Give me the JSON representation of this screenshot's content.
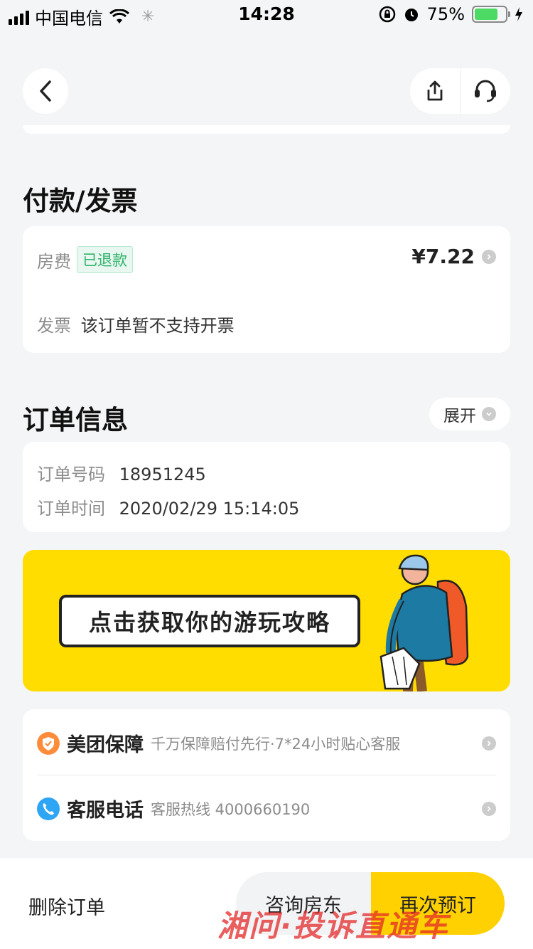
{
  "status_bar": {
    "carrier": "中国电信",
    "time": "14:28",
    "battery_percent": "75%",
    "battery_level": 0.75
  },
  "nav": {
    "back_icon": "chevron-left-icon",
    "share_icon": "share-icon",
    "support_icon": "headset-icon"
  },
  "payment": {
    "section_title": "付款/发票",
    "room_fee_label": "房费",
    "refund_tag": "已退款",
    "amount": "¥7.22",
    "invoice_label": "发票",
    "invoice_text": "该订单暂不支持开票"
  },
  "order": {
    "section_title": "订单信息",
    "expand_label": "展开",
    "number_label": "订单号码",
    "number_value": "18951245",
    "time_label": "订单时间",
    "time_value": "2020/02/29 15:14:05"
  },
  "banner": {
    "text": "点击获取你的游玩攻略",
    "color": "#ffdd00"
  },
  "services": [
    {
      "icon": "shield-check-icon",
      "title": "美团保障",
      "subtitle": "千万保障赔付先行·7*24小时贴心客服"
    },
    {
      "icon": "phone-icon",
      "title": "客服电话",
      "subtitle": "客服热线 4000660190"
    }
  ],
  "bottom_bar": {
    "delete_label": "删除订单",
    "consult_label": "咨询房东",
    "rebook_label": "再次预订",
    "accent": "#ffd100"
  },
  "watermark": "湘问·投诉直通车"
}
